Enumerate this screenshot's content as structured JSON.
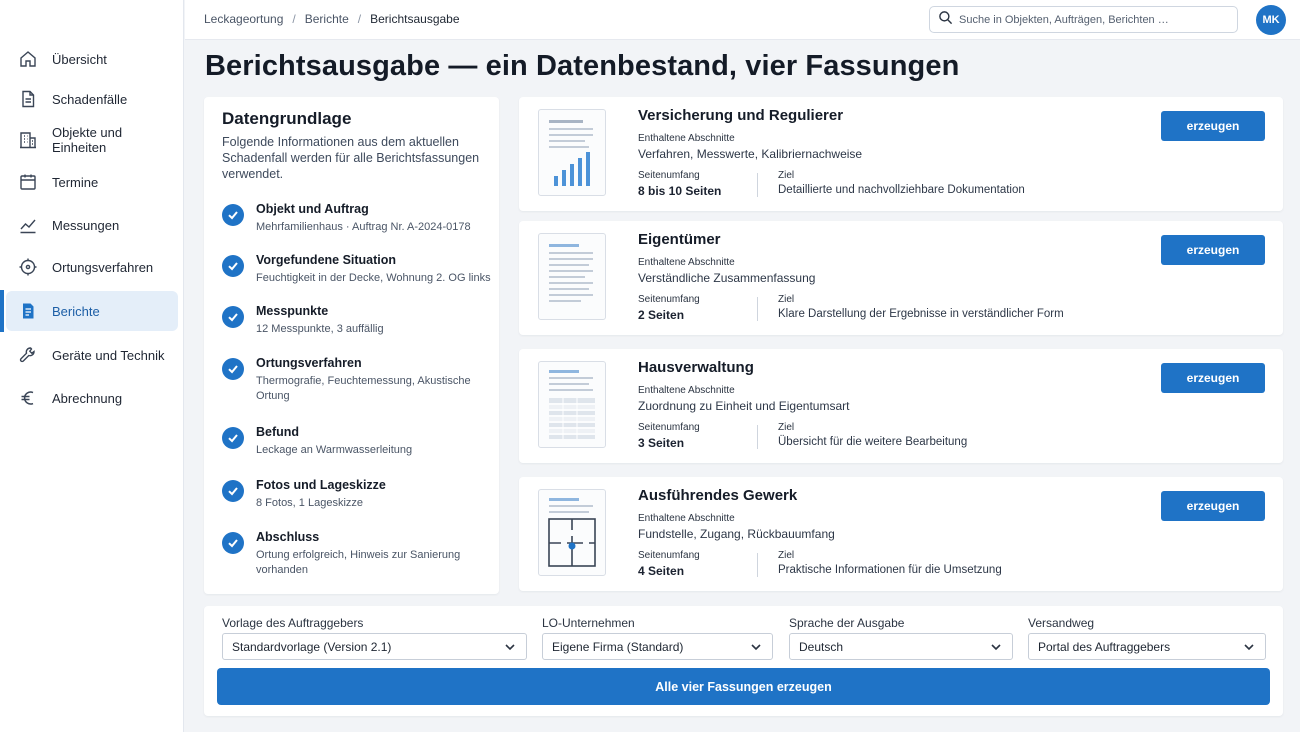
{
  "sidebar": {
    "items": [
      {
        "label": "Übersicht",
        "icon": "home-icon"
      },
      {
        "label": "Schadenfälle",
        "icon": "document-icon"
      },
      {
        "label": "Objekte und Einheiten",
        "icon": "building-icon"
      },
      {
        "label": "Termine",
        "icon": "calendar-icon"
      },
      {
        "label": "Messungen",
        "icon": "trend-chart-icon"
      },
      {
        "label": "Ortungsverfahren",
        "icon": "crosshair-icon"
      },
      {
        "label": "Berichte",
        "icon": "report-icon",
        "active": true
      },
      {
        "label": "Geräte und Technik",
        "icon": "wrench-icon"
      },
      {
        "label": "Abrechnung",
        "icon": "euro-icon"
      }
    ]
  },
  "header": {
    "breadcrumb": [
      "Leckageortung",
      "Berichte",
      "Berichtsausgabe"
    ],
    "search_placeholder": "Suche in Objekten, Aufträgen, Berichten …",
    "avatar_initials": "MK"
  },
  "page_title": "Berichtsausgabe — ein Datenbestand, vier Fassungen",
  "data_basis": {
    "title": "Datengrundlage",
    "intro": "Folgende Informationen aus dem aktuellen Schadenfall werden für alle Berichtsfassungen verwendet.",
    "items": [
      {
        "title": "Objekt und Auftrag",
        "detail": "Mehrfamilienhaus · Auftrag Nr. A-2024-0178"
      },
      {
        "title": "Vorgefundene Situation",
        "detail": "Feuchtigkeit in der Decke, Wohnung 2. OG links"
      },
      {
        "title": "Messpunkte",
        "detail": "12 Messpunkte, 3 auffällig"
      },
      {
        "title": "Ortungsverfahren",
        "detail": "Thermografie, Feuchtemessung, Akustische Ortung"
      },
      {
        "title": "Befund",
        "detail": "Leckage an Warmwasserleitung"
      },
      {
        "title": "Fotos und Lageskizze",
        "detail": "8 Fotos, 1 Lageskizze"
      },
      {
        "title": "Abschluss",
        "detail": "Ortung erfolgreich, Hinweis zur Sanierung vorhanden"
      }
    ]
  },
  "versions_common": {
    "sections_label": "Enthaltene Abschnitte",
    "pages_label": "Seitenumfang",
    "goal_label": "Ziel",
    "button_label": "erzeugen"
  },
  "versions": [
    {
      "title": "Versicherung und Regulierer",
      "sections": "Verfahren, Messwerte, Kalibriernachweise",
      "pages": "8 bis 10 Seiten",
      "goal": "Detaillierte und nachvollziehbare Dokumentation",
      "thumb": "bar-chart-thumbnail-icon"
    },
    {
      "title": "Eigentümer",
      "sections": "Verständliche Zusammenfassung",
      "pages": "2 Seiten",
      "goal": "Klare Darstellung der Ergebnisse in verständlicher Form",
      "thumb": "text-page-thumbnail-icon"
    },
    {
      "title": "Hausverwaltung",
      "sections": "Zuordnung zu Einheit und Eigentumsart",
      "pages": "3 Seiten",
      "goal": "Übersicht für die weitere Bearbeitung",
      "thumb": "table-thumbnail-icon"
    },
    {
      "title": "Ausführendes Gewerk",
      "sections": "Fundstelle, Zugang, Rückbauumfang",
      "pages": "4 Seiten",
      "goal": "Praktische Informationen für die Umsetzung",
      "thumb": "floor-plan-thumbnail-icon"
    }
  ],
  "options": {
    "template": {
      "label": "Vorlage des Auftraggebers",
      "value": "Standardvorlage (Version 2.1)"
    },
    "company": {
      "label": "LO-Unternehmen",
      "value": "Eigene Firma (Standard)"
    },
    "language": {
      "label": "Sprache der Ausgabe",
      "value": "Deutsch"
    },
    "delivery": {
      "label": "Versandweg",
      "value": "Portal des Auftraggebers"
    },
    "generate_all_label": "Alle vier Fassungen erzeugen"
  },
  "colors": {
    "accent": "#1f73c6",
    "active_bg": "#e4eef9",
    "page_bg": "#f2f4f7"
  }
}
